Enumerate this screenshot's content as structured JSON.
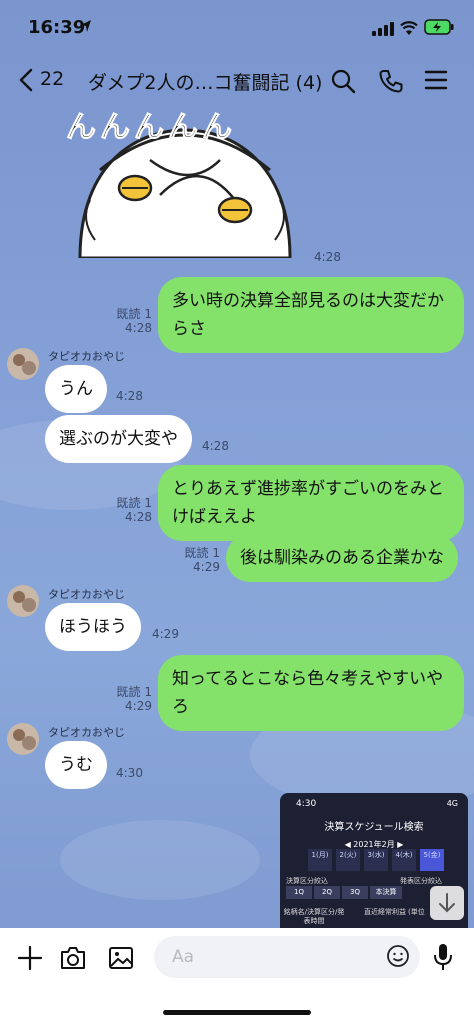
{
  "status_bar": {
    "time": "16:39"
  },
  "header": {
    "unread_count": "22",
    "title": "ダメプ2人の…コ奮闘記 (4)"
  },
  "sticker": {
    "caption": "んんんんん",
    "time": "4:28"
  },
  "messages": [
    {
      "type": "sent",
      "text": "多い時の決算全部見るのは大変だからさ",
      "read": "既読 1",
      "time": "4:28"
    },
    {
      "type": "received",
      "sender": "タピオカおやじ",
      "text": "うん",
      "time": "4:28"
    },
    {
      "type": "received",
      "text": "選ぶのが大変や",
      "time": "4:28"
    },
    {
      "type": "sent",
      "text": "とりあえず進捗率がすごいのをみとけばええよ",
      "read": "既読 1",
      "time": "4:28"
    },
    {
      "type": "sent",
      "text": "後は馴染みのある企業かな",
      "read": "既読 1",
      "time": "4:29"
    },
    {
      "type": "received",
      "sender": "タピオカおやじ",
      "text": "ほうほう",
      "time": "4:29"
    },
    {
      "type": "sent",
      "text": "知ってるとこなら色々考えやすいやろ",
      "read": "既読 1",
      "time": "4:29"
    },
    {
      "type": "received",
      "sender": "タピオカおやじ",
      "text": "うむ",
      "time": "4:30"
    }
  ],
  "preview": {
    "time": "4:30",
    "status": "4G",
    "title": "決算スケジュール検索",
    "month": "◀ 2021年2月 ▶",
    "days": [
      "1(月)",
      "2(火)",
      "3(水)",
      "4(木)",
      "5(金)"
    ],
    "label_left": "決算区分絞込",
    "label_right": "発表区分絞込",
    "tabs": [
      "1Q",
      "2Q",
      "3Q",
      "本決算"
    ],
    "col1": "銘柄名/決算区分/発表時間",
    "col2": "直近経常利益",
    "col3": "(単位"
  },
  "input": {
    "placeholder": "Aa"
  },
  "colors": {
    "sent_bubble": "#84e26b",
    "received_bubble": "#ffffff",
    "chat_background": "#84a0d6"
  }
}
